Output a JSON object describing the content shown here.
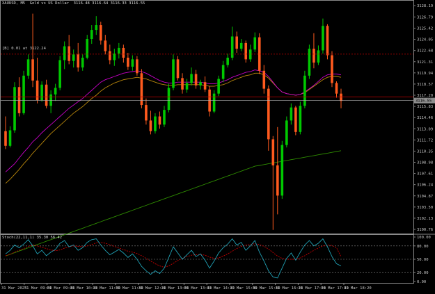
{
  "header": {
    "symbol": "XAUUSD, M5",
    "description": "Gold vs US Dollar",
    "ohlc": "3116.48 3116.64 3116.33 3116.55"
  },
  "level_label": "[B] 0.01 at 3122.24",
  "indicator_label": "Stoch(22,11,1) 35.30 56.42",
  "price_axis": {
    "ticks": [
      "3128.19",
      "3126.79",
      "3125.42",
      "3124.05",
      "3122.68",
      "3121.31",
      "3119.94",
      "3118.57",
      "3117.20",
      "3115.83",
      "3114.46",
      "3113.09",
      "3111.72",
      "3110.35",
      "3108.98",
      "3107.61",
      "3106.24",
      "3104.87",
      "3103.50",
      "3102.13",
      "3100.76"
    ],
    "current_price_tag": "3116.55",
    "current_price_color": "#8e8e8e"
  },
  "stoch_axis": {
    "ticks": [
      "100.00",
      "80.00",
      "50.00",
      "20.00",
      "0.00"
    ]
  },
  "time_axis": {
    "ticks": [
      "31 Mar 2025",
      "31 Mar 09:00",
      "31 Mar 09:40",
      "31 Mar 10:20",
      "31 Mar 11:00",
      "31 Mar 11:40",
      "31 Mar 12:20",
      "31 Mar 13:00",
      "31 Mar 13:40",
      "31 Mar 14:20",
      "31 Mar 15:00",
      "31 Mar 15:40",
      "31 Mar 16:20",
      "31 Mar 17:00",
      "31 Mar 17:40",
      "31 Mar 18:20"
    ]
  },
  "colors": {
    "bull": "#00c800",
    "bear": "#ff5a1e",
    "ma_fast": "#c800c8",
    "ma_mid": "#b8860b",
    "ma_slow": "#2e8b00",
    "stoch_main": "#20a0b4",
    "stoch_signal": "#c80000",
    "order_line": "#c80000"
  },
  "chart_data": {
    "type": "candlestick",
    "candles": [
      [
        3112.8,
        3114.6,
        3110.6,
        3111.0
      ],
      [
        3111.0,
        3113.4,
        3110.8,
        3112.9
      ],
      [
        3112.9,
        3118.8,
        3112.6,
        3118.2
      ],
      [
        3118.2,
        3119.4,
        3114.6,
        3115.0
      ],
      [
        3115.0,
        3120.2,
        3114.8,
        3119.6
      ],
      [
        3119.6,
        3122.2,
        3119.2,
        3121.6
      ],
      [
        3121.6,
        3127.2,
        3118.2,
        3119.0
      ],
      [
        3119.0,
        3121.8,
        3116.2,
        3116.6
      ],
      [
        3116.6,
        3118.9,
        3116.4,
        3118.5
      ],
      [
        3118.5,
        3119.1,
        3115.6,
        3115.9
      ],
      [
        3115.9,
        3117.8,
        3115.0,
        3117.3
      ],
      [
        3117.3,
        3118.6,
        3116.5,
        3118.1
      ],
      [
        3118.1,
        3122.0,
        3117.8,
        3121.5
      ],
      [
        3121.5,
        3123.8,
        3120.4,
        3123.2
      ],
      [
        3123.2,
        3124.6,
        3121.0,
        3121.4
      ],
      [
        3121.4,
        3122.8,
        3120.6,
        3122.2
      ],
      [
        3122.2,
        3123.6,
        3120.1,
        3120.6
      ],
      [
        3120.6,
        3122.2,
        3120.2,
        3121.8
      ],
      [
        3121.8,
        3124.6,
        3121.6,
        3124.1
      ],
      [
        3124.1,
        3125.8,
        3123.5,
        3125.2
      ],
      [
        3125.2,
        3126.9,
        3124.6,
        3125.8
      ],
      [
        3125.8,
        3126.2,
        3123.4,
        3123.9
      ],
      [
        3123.9,
        3124.6,
        3122.2,
        3122.6
      ],
      [
        3122.6,
        3123.4,
        3121.0,
        3121.5
      ],
      [
        3121.5,
        3122.9,
        3120.8,
        3122.3
      ],
      [
        3122.3,
        3123.6,
        3121.7,
        3123.0
      ],
      [
        3123.0,
        3123.4,
        3121.2,
        3121.8
      ],
      [
        3121.8,
        3122.4,
        3120.3,
        3120.7
      ],
      [
        3120.7,
        3122.1,
        3120.2,
        3121.6
      ],
      [
        3121.6,
        3122.0,
        3119.6,
        3119.9
      ],
      [
        3119.9,
        3120.4,
        3115.6,
        3116.0
      ],
      [
        3116.0,
        3116.8,
        3113.6,
        3114.1
      ],
      [
        3114.1,
        3115.3,
        3112.4,
        3112.8
      ],
      [
        3112.8,
        3115.0,
        3112.5,
        3114.6
      ],
      [
        3114.6,
        3115.2,
        3113.1,
        3113.6
      ],
      [
        3113.6,
        3115.9,
        3113.3,
        3115.4
      ],
      [
        3115.4,
        3118.6,
        3115.1,
        3118.1
      ],
      [
        3118.1,
        3122.2,
        3117.8,
        3121.6
      ],
      [
        3121.6,
        3122.0,
        3119.0,
        3119.3
      ],
      [
        3119.3,
        3119.9,
        3117.4,
        3117.9
      ],
      [
        3117.9,
        3119.2,
        3117.5,
        3118.7
      ],
      [
        3118.7,
        3120.6,
        3118.4,
        3119.8
      ],
      [
        3119.8,
        3120.3,
        3118.0,
        3118.4
      ],
      [
        3118.4,
        3119.1,
        3117.9,
        3118.8
      ],
      [
        3118.8,
        3119.5,
        3117.6,
        3117.9
      ],
      [
        3117.9,
        3118.3,
        3114.6,
        3115.2
      ],
      [
        3115.2,
        3117.8,
        3115.0,
        3117.4
      ],
      [
        3117.4,
        3119.6,
        3117.1,
        3119.2
      ],
      [
        3119.2,
        3121.4,
        3118.8,
        3120.9
      ],
      [
        3120.9,
        3122.3,
        3120.6,
        3121.8
      ],
      [
        3121.8,
        3125.6,
        3121.5,
        3124.4
      ],
      [
        3124.4,
        3125.0,
        3122.4,
        3122.9
      ],
      [
        3122.9,
        3124.1,
        3122.6,
        3123.6
      ],
      [
        3123.6,
        3123.9,
        3121.2,
        3121.6
      ],
      [
        3121.6,
        3123.4,
        3121.3,
        3122.8
      ],
      [
        3122.8,
        3124.9,
        3122.5,
        3124.3
      ],
      [
        3124.3,
        3124.8,
        3119.8,
        3120.2
      ],
      [
        3120.2,
        3120.9,
        3117.4,
        3118.0
      ],
      [
        3118.0,
        3118.4,
        3110.4,
        3111.8
      ],
      [
        3111.8,
        3112.2,
        3100.7,
        3108.6
      ],
      [
        3108.6,
        3113.3,
        3102.6,
        3104.9
      ],
      [
        3104.9,
        3111.6,
        3104.5,
        3111.1
      ],
      [
        3111.1,
        3114.6,
        3110.8,
        3114.1
      ],
      [
        3114.1,
        3116.2,
        3113.6,
        3115.7
      ],
      [
        3115.7,
        3115.9,
        3112.3,
        3112.7
      ],
      [
        3112.7,
        3116.4,
        3112.4,
        3115.9
      ],
      [
        3115.9,
        3120.2,
        3115.6,
        3119.6
      ],
      [
        3119.6,
        3123.4,
        3119.2,
        3122.9
      ],
      [
        3122.9,
        3124.8,
        3120.5,
        3121.2
      ],
      [
        3121.2,
        3123.3,
        3120.9,
        3122.7
      ],
      [
        3122.7,
        3126.6,
        3122.3,
        3125.7
      ],
      [
        3125.7,
        3125.9,
        3121.6,
        3122.1
      ],
      [
        3122.1,
        3122.6,
        3118.2,
        3118.7
      ],
      [
        3118.7,
        3118.9,
        3116.9,
        3117.4
      ],
      [
        3117.4,
        3118.0,
        3115.6,
        3116.5
      ]
    ],
    "ma_fast": [
      3107.8,
      3108.3,
      3108.8,
      3109.5,
      3110.2,
      3110.8,
      3111.5,
      3112.0,
      3112.6,
      3113.1,
      3113.6,
      3114.1,
      3114.6,
      3115.1,
      3115.6,
      3116.0,
      3116.4,
      3116.8,
      3117.3,
      3117.8,
      3118.3,
      3118.8,
      3119.1,
      3119.3,
      3119.5,
      3119.7,
      3119.9,
      3120.0,
      3120.1,
      3120.2,
      3120.1,
      3119.9,
      3119.6,
      3119.3,
      3119.0,
      3118.8,
      3118.7,
      3118.7,
      3118.8,
      3118.8,
      3118.8,
      3118.8,
      3118.8,
      3118.8,
      3118.7,
      3118.6,
      3118.6,
      3118.7,
      3118.9,
      3119.1,
      3119.4,
      3119.6,
      3119.8,
      3120.0,
      3120.1,
      3120.3,
      3120.2,
      3120.0,
      3119.5,
      3118.8,
      3118.1,
      3117.6,
      3117.4,
      3117.3,
      3117.2,
      3117.3,
      3117.6,
      3118.0,
      3118.4,
      3118.9,
      3119.4,
      3119.7,
      3119.8,
      3119.8,
      3119.7
    ],
    "ma_mid": [
      3106.4,
      3106.9,
      3107.5,
      3108.1,
      3108.8,
      3109.4,
      3110.1,
      3110.7,
      3111.3,
      3111.9,
      3112.5,
      3113.0,
      3113.5,
      3114.0,
      3114.5,
      3115.0,
      3115.4,
      3115.8,
      3116.3,
      3116.8,
      3117.2,
      3117.7,
      3118.1,
      3118.4,
      3118.7,
      3118.9,
      3119.1,
      3119.2,
      3119.3,
      3119.4,
      3119.3,
      3119.2,
      3119.0,
      3118.8,
      3118.6,
      3118.5,
      3118.4,
      3118.4,
      3118.5,
      3118.5,
      3118.5,
      3118.5,
      3118.5,
      3118.5,
      3118.4,
      3118.3,
      3118.3,
      3118.4,
      3118.5,
      3118.7,
      3119.0,
      3119.2,
      3119.4,
      3119.6,
      3119.7,
      3119.9,
      3119.9,
      3119.7,
      3119.3,
      3118.7,
      3118.1,
      3117.6,
      3117.4,
      3117.3,
      3117.2,
      3117.3,
      3117.5,
      3117.9,
      3118.3,
      3118.7,
      3119.1,
      3119.4,
      3119.5,
      3119.5,
      3119.4
    ],
    "ma_slow": [
      3097.5,
      3097.7,
      3097.9,
      3098.1,
      3098.3,
      3098.5,
      3098.7,
      3098.9,
      3099.1,
      3099.3,
      3099.5,
      3099.7,
      3099.9,
      3100.1,
      3100.3,
      3100.5,
      3100.7,
      3100.9,
      3101.1,
      3101.3,
      3101.5,
      3101.7,
      3101.9,
      3102.1,
      3102.3,
      3102.5,
      3102.7,
      3102.9,
      3103.1,
      3103.3,
      3103.5,
      3103.7,
      3103.9,
      3104.1,
      3104.3,
      3104.5,
      3104.7,
      3104.9,
      3105.1,
      3105.3,
      3105.5,
      3105.7,
      3105.9,
      3106.1,
      3106.3,
      3106.5,
      3106.7,
      3106.9,
      3107.1,
      3107.3,
      3107.5,
      3107.7,
      3107.9,
      3108.1,
      3108.3,
      3108.5,
      3108.6,
      3108.7,
      3108.8,
      3108.9,
      3109.0,
      3109.1,
      3109.2,
      3109.3,
      3109.4,
      3109.5,
      3109.6,
      3109.7,
      3109.8,
      3109.9,
      3110.0,
      3110.1,
      3110.2,
      3110.3,
      3110.4
    ],
    "stoch_main": [
      62,
      70,
      82,
      76,
      84,
      94,
      80,
      62,
      70,
      58,
      66,
      72,
      86,
      92,
      78,
      82,
      70,
      76,
      88,
      94,
      96,
      82,
      70,
      60,
      66,
      72,
      64,
      54,
      62,
      50,
      34,
      24,
      16,
      24,
      18,
      30,
      54,
      78,
      64,
      50,
      60,
      70,
      56,
      62,
      48,
      30,
      46,
      64,
      76,
      84,
      96,
      82,
      88,
      70,
      80,
      92,
      66,
      46,
      24,
      10,
      8,
      30,
      52,
      64,
      48,
      66,
      82,
      92,
      80,
      86,
      96,
      78,
      56,
      40,
      35
    ],
    "stoch_signal": [
      58,
      61,
      66,
      70,
      74,
      79,
      82,
      80,
      77,
      74,
      71,
      69,
      71,
      75,
      78,
      80,
      79,
      78,
      80,
      83,
      87,
      88,
      86,
      83,
      79,
      75,
      72,
      68,
      66,
      63,
      58,
      52,
      46,
      40,
      35,
      32,
      35,
      41,
      47,
      52,
      56,
      59,
      60,
      61,
      59,
      55,
      52,
      53,
      57,
      62,
      68,
      74,
      79,
      82,
      83,
      85,
      83,
      79,
      73,
      65,
      57,
      52,
      50,
      50,
      50,
      53,
      58,
      64,
      70,
      75,
      80,
      82,
      81,
      76,
      56
    ]
  }
}
